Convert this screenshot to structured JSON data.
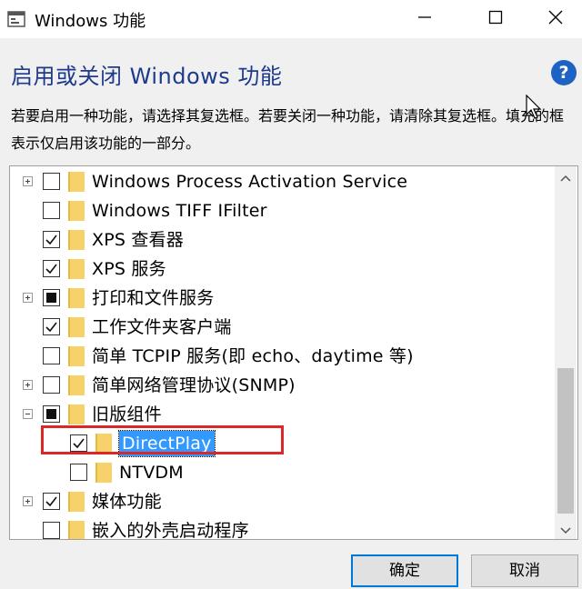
{
  "window": {
    "title": "Windows 功能",
    "heading": "启用或关闭 Windows 功能",
    "help_symbol": "?",
    "description": "若要启用一种功能，请选择其复选框。若要关闭一种功能，请清除其复选框。填充的框表示仅启用该功能的一部分。"
  },
  "features": [
    {
      "label": "Windows Process Activation Service",
      "expander": "plus",
      "state": "unchecked",
      "level": 0
    },
    {
      "label": "Windows TIFF IFilter",
      "expander": "none",
      "state": "unchecked",
      "level": 0
    },
    {
      "label": "XPS 查看器",
      "expander": "none",
      "state": "checked",
      "level": 0
    },
    {
      "label": "XPS 服务",
      "expander": "none",
      "state": "checked",
      "level": 0
    },
    {
      "label": "打印和文件服务",
      "expander": "plus",
      "state": "partial",
      "level": 0
    },
    {
      "label": "工作文件夹客户端",
      "expander": "none",
      "state": "checked",
      "level": 0
    },
    {
      "label": "简单 TCPIP 服务(即 echo、daytime 等)",
      "expander": "none",
      "state": "unchecked",
      "level": 0
    },
    {
      "label": "简单网络管理协议(SNMP)",
      "expander": "plus",
      "state": "unchecked",
      "level": 0
    },
    {
      "label": "旧版组件",
      "expander": "minus",
      "state": "partial",
      "level": 0
    },
    {
      "label": "DirectPlay",
      "expander": "none",
      "state": "checked",
      "level": 1,
      "selected": true
    },
    {
      "label": "NTVDM",
      "expander": "none",
      "state": "unchecked",
      "level": 1
    },
    {
      "label": "媒体功能",
      "expander": "plus",
      "state": "checked",
      "level": 0
    },
    {
      "label": "嵌入的外壳启动程序",
      "expander": "none",
      "state": "unchecked",
      "level": 0
    }
  ],
  "buttons": {
    "ok": "确定",
    "cancel": "取消"
  },
  "colors": {
    "heading": "#1e3a8c",
    "selection": "#3399ff",
    "highlight_border": "#d92828",
    "folder": "#f7d26a"
  },
  "icons": {
    "app": "windows-features-icon",
    "minimize": "minimize-icon",
    "maximize": "maximize-icon",
    "close": "close-icon",
    "help": "help-icon",
    "cursor": "mouse-cursor-icon"
  }
}
